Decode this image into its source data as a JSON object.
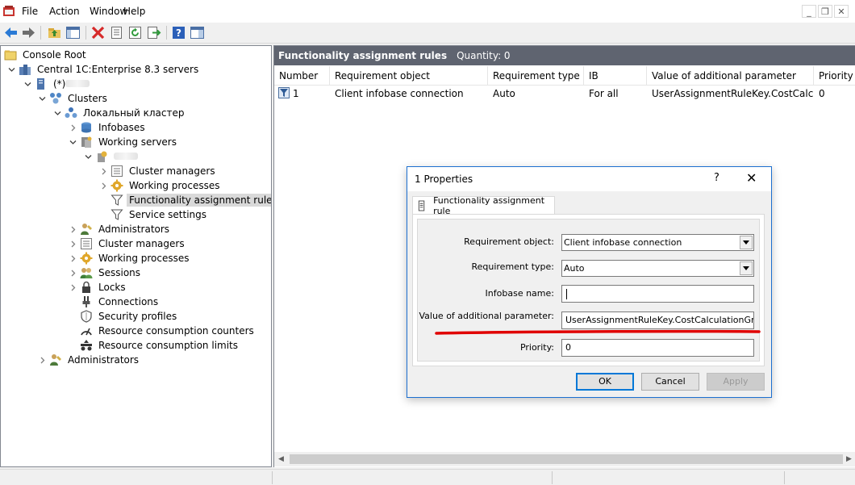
{
  "menu": {
    "items": [
      "File",
      "Action",
      "Window",
      "Help"
    ],
    "mdi_controls": [
      "_",
      "❐",
      "✕"
    ]
  },
  "toolbar": {
    "buttons": [
      "back-icon",
      "forward-icon",
      "up-folder-icon",
      "show-hide-tree-icon",
      "delete-icon",
      "properties-icon",
      "refresh-icon",
      "export-list-icon",
      "help-icon",
      "show-panel-icon"
    ]
  },
  "tree": {
    "console_root": "Console Root",
    "central_servers": "Central 1C:Enterprise 8.3 servers",
    "server_name": "(*)",
    "clusters": "Clusters",
    "local_cluster": "Локальный кластер",
    "infobases": "Infobases",
    "working_servers": "Working servers",
    "ws_cluster_managers": "Cluster managers",
    "ws_working_processes": "Working processes",
    "ws_functionality_rules": "Functionality assignment rules",
    "ws_service_settings": "Service settings",
    "administrators": "Administrators",
    "cluster_managers": "Cluster managers",
    "working_processes": "Working processes",
    "sessions": "Sessions",
    "locks": "Locks",
    "connections": "Connections",
    "security_profiles": "Security profiles",
    "resource_counters": "Resource consumption counters",
    "resource_limits": "Resource consumption limits",
    "central_administrators": "Administrators"
  },
  "list": {
    "title": "Functionality assignment rules",
    "quantity": "Quantity: 0",
    "columns": [
      "Number",
      "Requirement object",
      "Requirement type",
      "IB",
      "Value of additional parameter",
      "Priority"
    ],
    "rows": [
      [
        "1",
        "Client infobase connection",
        "Auto",
        "For all",
        "UserAssignmentRuleKey.CostCalcu...",
        "0"
      ]
    ]
  },
  "dialog": {
    "title": "1 Properties",
    "help": "?",
    "close": "✕",
    "tab": "Functionality assignment rule",
    "requirement_object_label": "Requirement object:",
    "requirement_object_value": "Client infobase connection",
    "requirement_type_label": "Requirement type:",
    "requirement_type_value": "Auto",
    "infobase_name_label": "Infobase name:",
    "infobase_name_value": "",
    "additional_param_label": "Value of additional parameter:",
    "additional_param_value": "UserAssignmentRuleKey.CostCalculationGroup",
    "priority_label": "Priority:",
    "priority_value": "0",
    "ok": "OK",
    "cancel": "Cancel",
    "apply": "Apply"
  },
  "colors": {
    "header_bar": "#5f6470",
    "dialog_border": "#1c6fd0",
    "annotation_underline": "#e00000",
    "selection": "#d9d9d9"
  }
}
